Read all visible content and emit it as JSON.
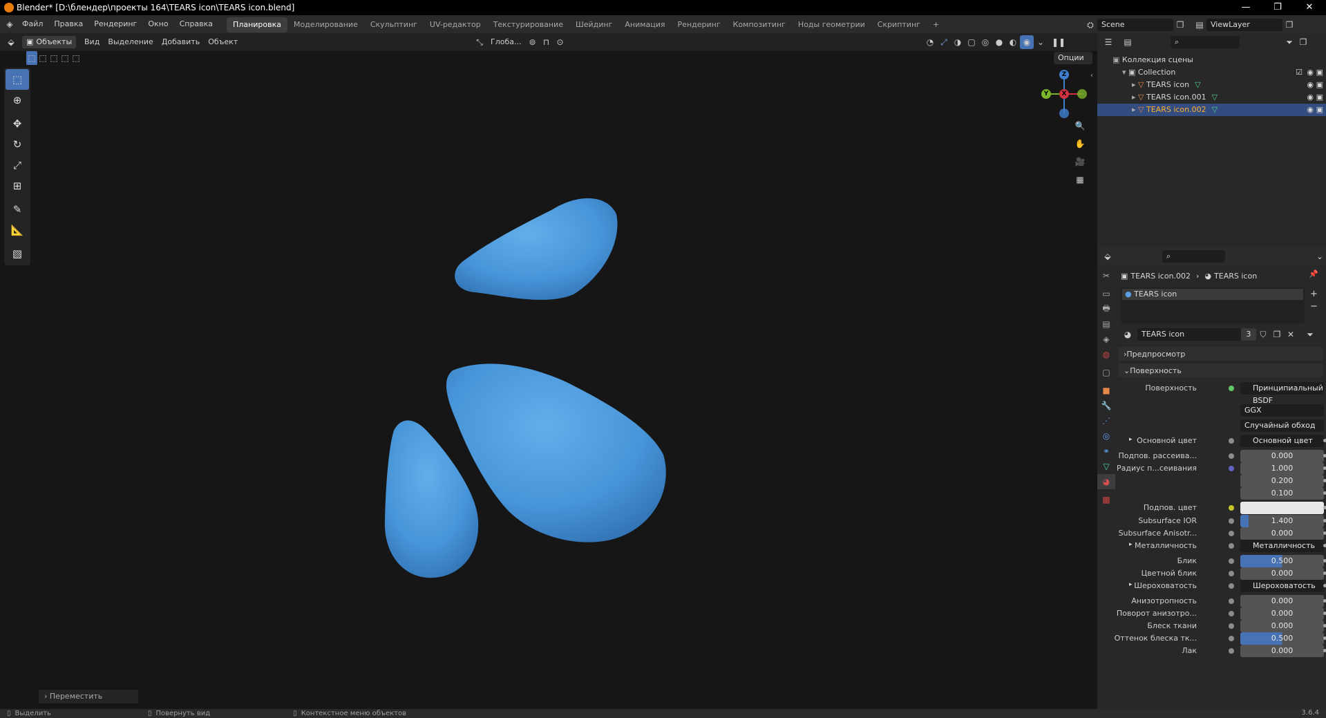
{
  "window": {
    "title": "Blender* [D:\\блендер\\проекты 164\\TEARS icon\\TEARS icon.blend]",
    "minimize": "—",
    "maximize": "❐",
    "close": "✕"
  },
  "menus": [
    "Файл",
    "Правка",
    "Рендеринг",
    "Окно",
    "Справка"
  ],
  "workspaces": [
    {
      "label": "Планировка",
      "active": true
    },
    {
      "label": "Моделирование"
    },
    {
      "label": "Скульптинг"
    },
    {
      "label": "UV-редактор"
    },
    {
      "label": "Текстурирование"
    },
    {
      "label": "Шейдинг"
    },
    {
      "label": "Анимация"
    },
    {
      "label": "Рендеринг"
    },
    {
      "label": "Композитинг"
    },
    {
      "label": "Ноды геометрии"
    },
    {
      "label": "Скриптинг"
    }
  ],
  "add_workspace": "+",
  "scene": {
    "name": "Scene",
    "view_layer": "ViewLayer"
  },
  "viewport": {
    "mode": "Объекты",
    "menus": [
      "Вид",
      "Выделение",
      "Добавить",
      "Объект"
    ],
    "orientation": "Глоба...",
    "options": "Опции",
    "gizmo": {
      "z": "Z",
      "y": "Y",
      "x": "X"
    },
    "last_operator": "Переместить"
  },
  "outliner": {
    "root": "Коллекция сцены",
    "collection": "Collection",
    "objects": [
      {
        "name": "TEARS icon",
        "selected": false
      },
      {
        "name": "TEARS icon.001",
        "selected": false
      },
      {
        "name": "TEARS icon.002",
        "selected": true
      }
    ]
  },
  "properties": {
    "breadcrumb_object": "TEARS icon.002",
    "breadcrumb_material": "TEARS icon",
    "slot": "TEARS icon",
    "material_name": "TEARS icon",
    "users": "3",
    "panels": {
      "preview": "Предпросмотр",
      "surface": "Поверхность"
    },
    "surface_label": "Поверхность",
    "surface_shader": "Принципиальный BSDF",
    "distribution": "GGX",
    "subsurface_method": "Случайный обход",
    "rows": [
      {
        "label": "Основной цвет",
        "value": "Основной цвет",
        "type": "link",
        "expand": true
      },
      {
        "label": "Подпов. рассеива...",
        "value": "0.000",
        "type": "num"
      },
      {
        "label": "Радиус п...сеивания",
        "value": "1.000",
        "type": "num",
        "dot": "purple"
      },
      {
        "label": "",
        "value": "0.200",
        "type": "num",
        "nodot": true
      },
      {
        "label": "",
        "value": "0.100",
        "type": "num",
        "nodot": true
      },
      {
        "label": "Подпов. цвет",
        "value": "",
        "type": "color",
        "color": "#e8e8e8"
      },
      {
        "label": "Subsurface IOR",
        "value": "1.400",
        "type": "bar",
        "fill": 0.1
      },
      {
        "label": "Subsurface Anisotr...",
        "value": "0.000",
        "type": "num"
      },
      {
        "label": "Металличность",
        "value": "Металличность",
        "type": "link",
        "expand": true
      },
      {
        "label": "Блик",
        "value": "0.500",
        "type": "bar",
        "fill": 0.5
      },
      {
        "label": "Цветной блик",
        "value": "0.000",
        "type": "num"
      },
      {
        "label": "Шероховатость",
        "value": "Шероховатость",
        "type": "link",
        "expand": true
      },
      {
        "label": "Анизотропность",
        "value": "0.000",
        "type": "num"
      },
      {
        "label": "Поворот анизотро...",
        "value": "0.000",
        "type": "num"
      },
      {
        "label": "Блеск ткани",
        "value": "0.000",
        "type": "num"
      },
      {
        "label": "Оттенок блеска тк...",
        "value": "0.500",
        "type": "bar",
        "fill": 0.5
      },
      {
        "label": "Лак",
        "value": "0.000",
        "type": "num"
      }
    ]
  },
  "statusbar": {
    "select": "Выделить",
    "rotate": "Повернуть вид",
    "context": "Контекстное меню объектов",
    "version": "3.6.4"
  },
  "colors": {
    "accent": "#4772b3",
    "drop": "#4a9be0",
    "background": "#161616"
  }
}
